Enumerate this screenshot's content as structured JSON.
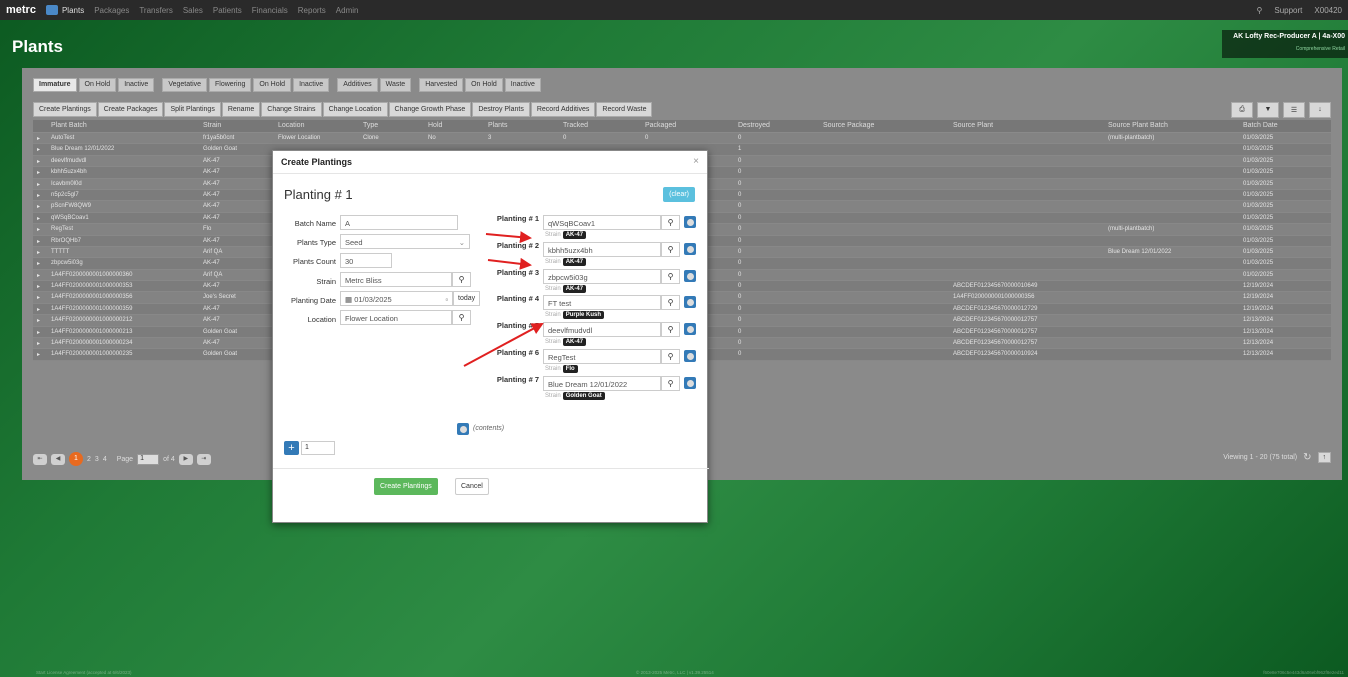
{
  "topnav": {
    "brand": "metrc",
    "items": [
      "Plants",
      "Packages",
      "Transfers",
      "Sales",
      "Patients",
      "Financials",
      "Reports",
      "Admin"
    ],
    "right": [
      "Support",
      "X00420"
    ]
  },
  "page": {
    "title": "Plants"
  },
  "facility": {
    "name": "AK Lofty Rec-Producer A",
    "license": "4a-X00",
    "sub": "Comprehensive Retail"
  },
  "tabs": [
    "Immature",
    "On Hold",
    "Inactive",
    "Vegetative",
    "Flowering",
    "On Hold",
    "Inactive",
    "Additives",
    "Waste",
    "Harvested",
    "On Hold",
    "Inactive"
  ],
  "actions": [
    "Create Plantings",
    "Create Packages",
    "Split Plantings",
    "Rename",
    "Change Strains",
    "Change Location",
    "Change Growth Phase",
    "Destroy Plants",
    "Record Additives",
    "Record Waste"
  ],
  "grid": {
    "columns": [
      "Plant Batch",
      "Strain",
      "Location",
      "Type",
      "Hold",
      "Plants",
      "Tracked",
      "Packaged",
      "Destroyed",
      "Source Package",
      "Source Plant",
      "Source Plant Batch",
      "Batch Date"
    ],
    "rows": [
      {
        "batch": "AutoTest",
        "strain": "fr1ya5b0cnt",
        "location": "Flower Location",
        "type": "Clone",
        "hold": "No",
        "plants": "3",
        "tracked": "0",
        "packaged": "0",
        "destroyed": "0",
        "source_plant": "",
        "source_batch": "(multi-plantbatch)",
        "date": "01/03/2025"
      },
      {
        "batch": "Blue Dream 12/01/2022",
        "strain": "Golden Goat",
        "destroyed": "1",
        "source_plant": "",
        "source_batch": "",
        "date": "01/03/2025"
      },
      {
        "batch": "deevlfmudvdl",
        "strain": "AK-47",
        "destroyed": "0",
        "source_plant": "",
        "source_batch": "",
        "date": "01/03/2025"
      },
      {
        "batch": "kbhh5uzx4bh",
        "strain": "AK-47",
        "destroyed": "0",
        "source_plant": "",
        "source_batch": "",
        "date": "01/03/2025"
      },
      {
        "batch": "Icavbm0l0d",
        "strain": "AK-47",
        "destroyed": "0",
        "source_plant": "",
        "source_batch": "",
        "date": "01/03/2025"
      },
      {
        "batch": "n5p2c5gl7",
        "strain": "AK-47",
        "destroyed": "0",
        "source_plant": "",
        "source_batch": "",
        "date": "01/03/2025"
      },
      {
        "batch": "pScnFW8QW9",
        "strain": "AK-47",
        "destroyed": "0",
        "source_plant": "",
        "source_batch": "",
        "date": "01/03/2025"
      },
      {
        "batch": "qWSqBCoav1",
        "strain": "AK-47",
        "destroyed": "0",
        "source_plant": "",
        "source_batch": "",
        "date": "01/03/2025"
      },
      {
        "batch": "RegTest",
        "strain": "Flo",
        "destroyed": "0",
        "source_plant": "",
        "source_batch": "(multi-plantbatch)",
        "date": "01/03/2025"
      },
      {
        "batch": "RbrOQHb7",
        "strain": "AK-47",
        "destroyed": "0",
        "source_plant": "",
        "source_batch": "",
        "date": "01/03/2025"
      },
      {
        "batch": "TTTTT",
        "strain": "Arif QA",
        "destroyed": "0",
        "source_plant": "",
        "source_batch": "Blue Dream 12/01/2022",
        "date": "01/03/2025"
      },
      {
        "batch": "zbpcw5i03g",
        "strain": "AK-47",
        "destroyed": "0",
        "source_plant": "",
        "source_batch": "",
        "date": "01/03/2025"
      },
      {
        "batch": "1A4FF0200000001000000360",
        "strain": "Arif QA",
        "destroyed": "0",
        "source_plant": "",
        "source_batch": "",
        "date": "01/02/2025"
      },
      {
        "batch": "1A4FF0200000001000000353",
        "strain": "AK-47",
        "destroyed": "0",
        "source_plant": "ABCDEF012345670000010649",
        "source_batch": "",
        "date": "12/19/2024"
      },
      {
        "batch": "1A4FF0200000001000000356",
        "strain": "Joe's Secret",
        "destroyed": "0",
        "source_plant": "1A4FF0200000001000000356",
        "source_batch": "",
        "date": "12/19/2024"
      },
      {
        "batch": "1A4FF0200000001000000359",
        "strain": "AK-47",
        "destroyed": "0",
        "source_plant": "ABCDEF012345670000012729",
        "source_batch": "",
        "date": "12/19/2024"
      },
      {
        "batch": "1A4FF0200000001000000212",
        "strain": "AK-47",
        "destroyed": "0",
        "source_plant": "ABCDEF012345670000012757",
        "source_batch": "",
        "date": "12/13/2024"
      },
      {
        "batch": "1A4FF0200000001000000213",
        "strain": "Golden Goat",
        "destroyed": "0",
        "source_plant": "ABCDEF012345670000012757",
        "source_batch": "",
        "date": "12/13/2024"
      },
      {
        "batch": "1A4FF0200000001000000234",
        "strain": "AK-47",
        "destroyed": "0",
        "source_plant": "ABCDEF012345670000012757",
        "source_batch": "",
        "date": "12/13/2024"
      },
      {
        "batch": "1A4FF0200000001000000235",
        "strain": "Golden Goat",
        "destroyed": "0",
        "source_plant": "ABCDEF012345670000010924",
        "source_batch": "",
        "date": "12/13/2024"
      }
    ]
  },
  "pager": {
    "pages": [
      "2",
      "3",
      "4"
    ],
    "current": "1",
    "page_label": "Page",
    "page_value": "1",
    "of_label": "of 4",
    "viewing": "Viewing 1 - 20 (75 total)"
  },
  "footer": {
    "left": "Start License Agreement (accepted at 6/6/2023)",
    "center": "© 2013-2025 Metrc, LLC | v1.39.25514",
    "right": "f60e8e706c5e443d6a06ebf962f8e2ed11"
  },
  "modal": {
    "title": "Create Plantings",
    "close": "×",
    "planting_title": "Planting # 1",
    "clear": "(clear)",
    "fields": {
      "batch_name_label": "Batch Name",
      "batch_name": "A",
      "plants_type_label": "Plants Type",
      "plants_type": "Seed",
      "plants_count_label": "Plants Count",
      "plants_count": "30",
      "strain_label": "Strain",
      "strain": "Metrc Bliss",
      "planting_date_label": "Planting Date",
      "planting_date": "01/03/2025",
      "today": "today",
      "location_label": "Location",
      "location": "Flower Location"
    },
    "strain_prefix": "Strain",
    "plantings": [
      {
        "label": "Planting # 1",
        "value": "qWSqBCoav1",
        "strain": "AK-47"
      },
      {
        "label": "Planting # 2",
        "value": "kbhh5uzx4bh",
        "strain": "AK-47"
      },
      {
        "label": "Planting # 3",
        "value": "zbpcw5i03g",
        "strain": "AK-47"
      },
      {
        "label": "Planting # 4",
        "value": "FT test",
        "strain": "Purple Kush"
      },
      {
        "label": "Planting # 5",
        "value": "deevlfmudvdl",
        "strain": "AK-47"
      },
      {
        "label": "Planting # 6",
        "value": "RegTest",
        "strain": "Flo"
      },
      {
        "label": "Planting # 7",
        "value": "Blue Dream 12/01/2022",
        "strain": "Golden Goat"
      }
    ],
    "contents": "(contents)",
    "add_count": "1",
    "create_button": "Create Plantings",
    "cancel_button": "Cancel"
  },
  "colors": {
    "accent": "#337ab7",
    "success": "#5cb85c",
    "info": "#5bc0de",
    "annotation_arrow": "#e02020",
    "page_current": "#e86a1f"
  }
}
